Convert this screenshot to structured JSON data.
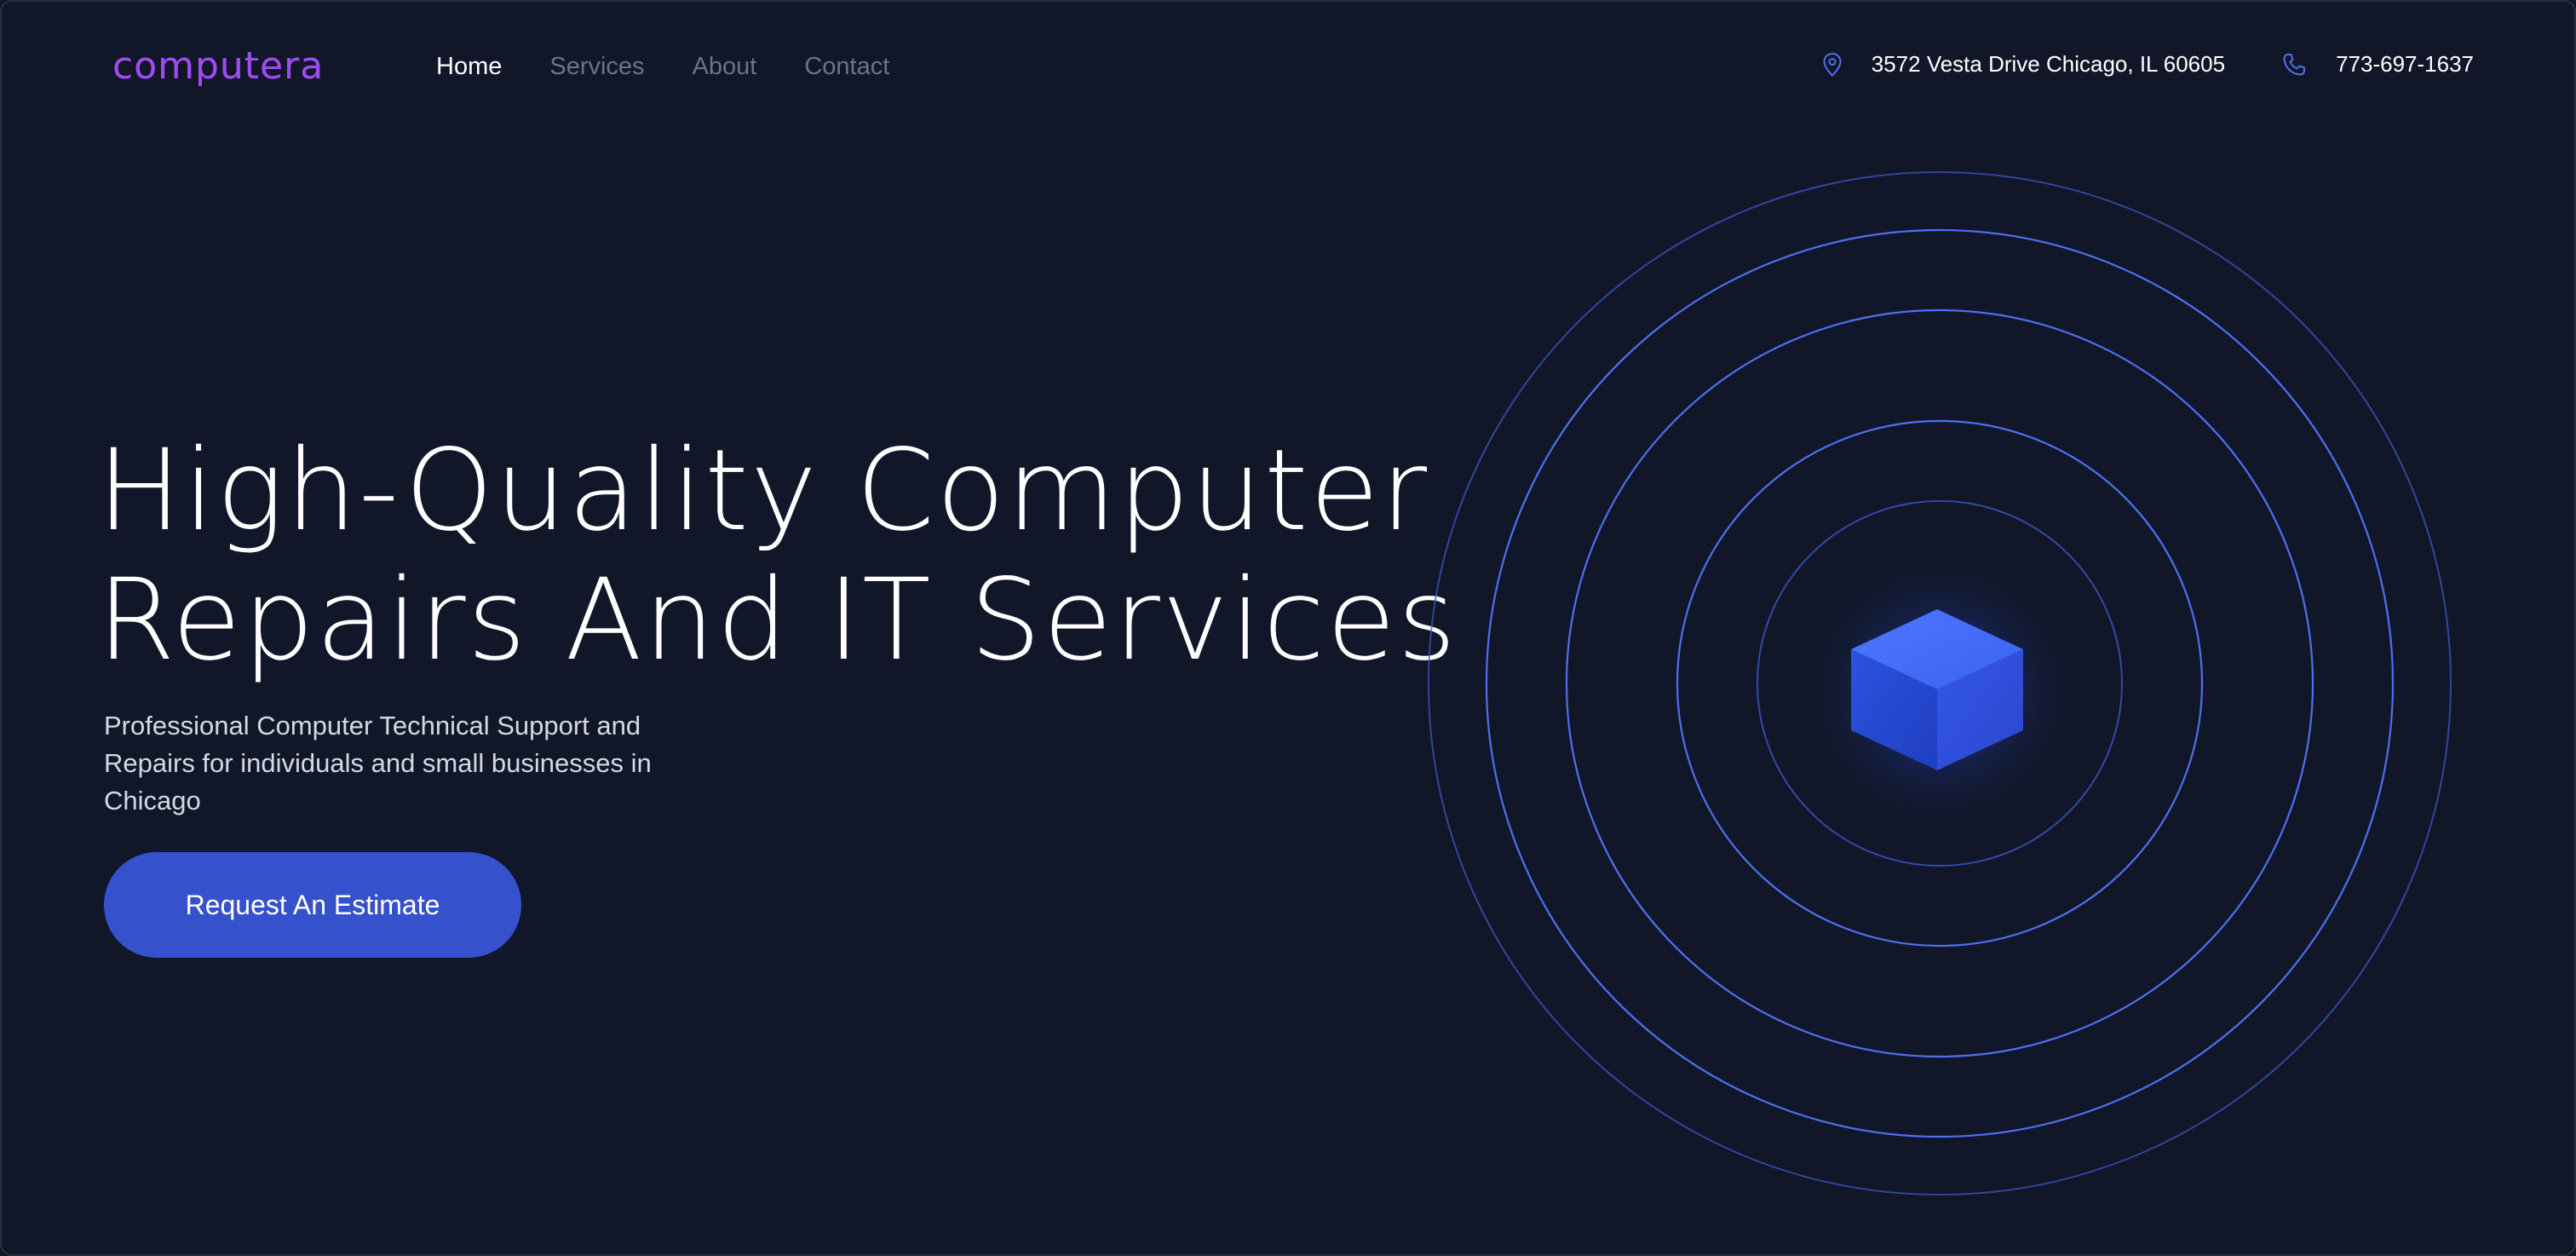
{
  "header": {
    "logo": "computera",
    "nav": [
      {
        "label": "Home",
        "active": true
      },
      {
        "label": "Services",
        "active": false
      },
      {
        "label": "About",
        "active": false
      },
      {
        "label": "Contact",
        "active": false
      }
    ],
    "address": "3572 Vesta Drive Chicago, IL 60605",
    "phone": "773-697-1637",
    "icons": {
      "address": "map-pin-icon",
      "phone": "phone-icon"
    }
  },
  "hero": {
    "headline_line1": "High-Quality Computer",
    "headline_line2": "Repairs And IT Services",
    "subtext": "Professional Computer Technical Support and Repairs for individuals and small businesses in Chicago",
    "cta_label": "Request An Estimate"
  },
  "art": {
    "icon": "cube-icon"
  },
  "colors": {
    "background": "#111729",
    "accent": "#3552cc",
    "logo": "#9d4bf2",
    "ring": "#4f6ff0",
    "nav_inactive": "#6b7385"
  }
}
